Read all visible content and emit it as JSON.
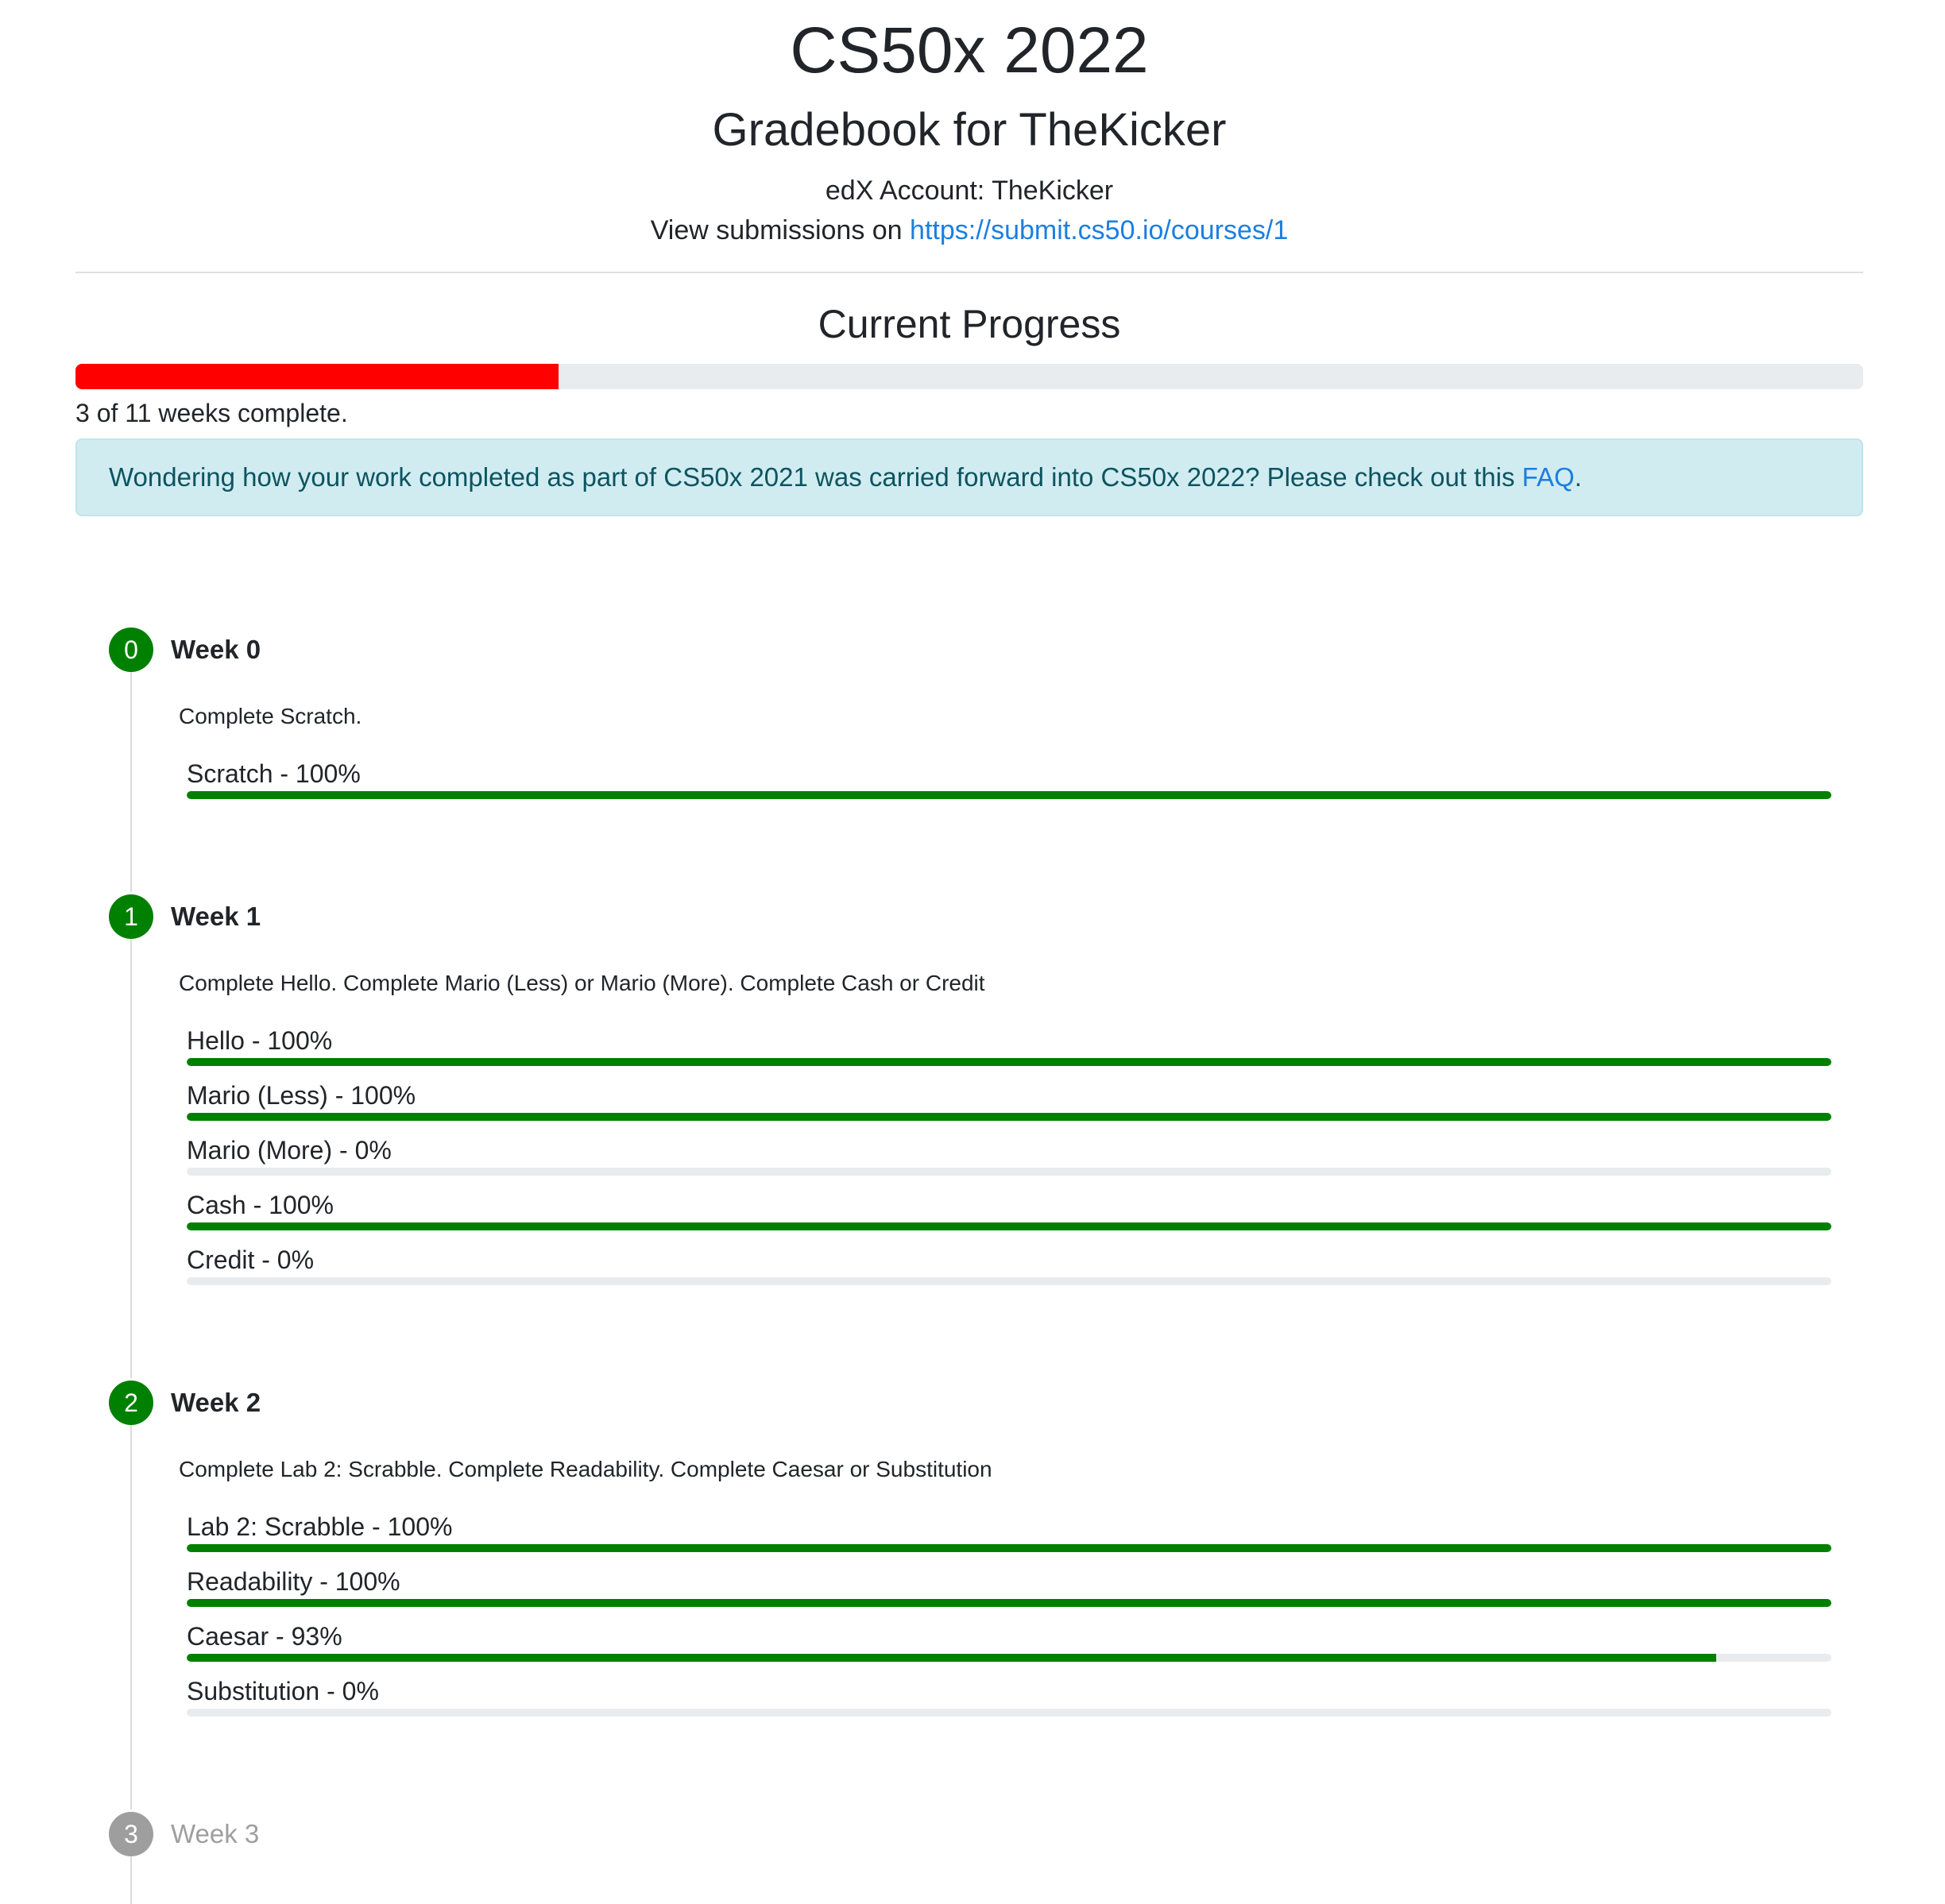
{
  "header": {
    "title": "CS50x 2022",
    "subtitle": "Gradebook for TheKicker",
    "account": "edX Account: TheKicker",
    "view_prefix": "View submissions on ",
    "view_link": "https://submit.cs50.io/courses/1"
  },
  "progress": {
    "heading": "Current Progress",
    "fraction": 0.27,
    "bar_color": "#ff0000",
    "status": "3 of 11 weeks complete."
  },
  "notice": {
    "text": "Wondering how your work completed as part of CS50x 2021 was carried forward into CS50x 2022? Please check out this ",
    "link": "FAQ",
    "suffix": "."
  },
  "colors": {
    "complete": "#008000",
    "inactive": "#9e9e9e",
    "track": "#e9ecef"
  },
  "weeks": [
    {
      "number": "0",
      "title": "Week 0",
      "description": "Complete Scratch.",
      "tasks": [
        {
          "label": "Scratch - 100%",
          "fraction": 1.0
        }
      ]
    },
    {
      "number": "1",
      "title": "Week 1",
      "description": "Complete Hello. Complete Mario (Less) or Mario (More). Complete Cash or Credit",
      "tasks": [
        {
          "label": "Hello - 100%",
          "fraction": 1.0
        },
        {
          "label": "Mario (Less) - 100%",
          "fraction": 1.0
        },
        {
          "label": "Mario (More) - 0%",
          "fraction": 0
        },
        {
          "label": "Cash - 100%",
          "fraction": 1.0
        },
        {
          "label": "Credit - 0%",
          "fraction": 0
        }
      ]
    },
    {
      "number": "2",
      "title": "Week 2",
      "description": "Complete Lab 2: Scrabble. Complete Readability. Complete Caesar or Substitution",
      "tasks": [
        {
          "label": "Lab 2: Scrabble - 100%",
          "fraction": 1.0
        },
        {
          "label": "Readability - 100%",
          "fraction": 1.0
        },
        {
          "label": "Caesar - 93%",
          "fraction": 0.93
        },
        {
          "label": "Substitution - 0%",
          "fraction": 0
        }
      ]
    },
    {
      "number": "3",
      "title": "Week 3",
      "inactive": true
    }
  ]
}
